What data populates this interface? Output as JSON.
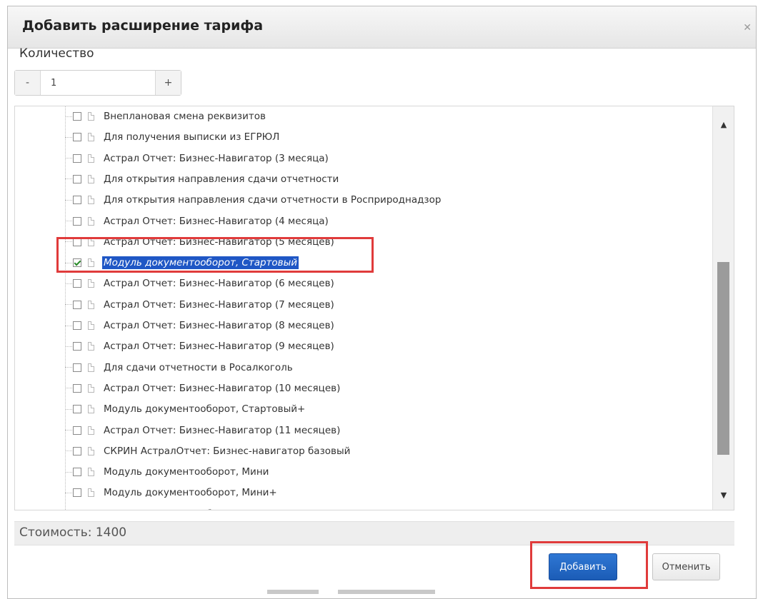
{
  "dialog": {
    "title": "Добавить расширение тарифа",
    "close_icon": "close-icon"
  },
  "quantity": {
    "label": "Количество",
    "minus_label": "-",
    "value": "1",
    "plus_label": "+"
  },
  "tree": {
    "items": [
      {
        "label": "Внеплановая смена реквизитов",
        "checked": false,
        "selected": false
      },
      {
        "label": "Для получения выписки из ЕГРЮЛ",
        "checked": false,
        "selected": false
      },
      {
        "label": "Астрал Отчет: Бизнес-Навигатор (3 месяца)",
        "checked": false,
        "selected": false
      },
      {
        "label": "Для открытия направления сдачи отчетности",
        "checked": false,
        "selected": false
      },
      {
        "label": "Для открытия направления сдачи отчетности в Росприроднадзор",
        "checked": false,
        "selected": false
      },
      {
        "label": "Астрал Отчет: Бизнес-Навигатор (4 месяца)",
        "checked": false,
        "selected": false
      },
      {
        "label": "Астрал Отчет: Бизнес-Навигатор (5 месяцев)",
        "checked": false,
        "selected": false
      },
      {
        "label": "Модуль документооборот, Стартовый",
        "checked": true,
        "selected": true
      },
      {
        "label": "Астрал Отчет: Бизнес-Навигатор (6 месяцев)",
        "checked": false,
        "selected": false
      },
      {
        "label": "Астрал Отчет: Бизнес-Навигатор (7 месяцев)",
        "checked": false,
        "selected": false
      },
      {
        "label": "Астрал Отчет: Бизнес-Навигатор (8 месяцев)",
        "checked": false,
        "selected": false
      },
      {
        "label": "Астрал Отчет: Бизнес-Навигатор (9 месяцев)",
        "checked": false,
        "selected": false
      },
      {
        "label": "Для сдачи отчетности в Росалкоголь",
        "checked": false,
        "selected": false
      },
      {
        "label": "Астрал Отчет: Бизнес-Навигатор (10 месяцев)",
        "checked": false,
        "selected": false
      },
      {
        "label": "Модуль документооборот, Стартовый+",
        "checked": false,
        "selected": false
      },
      {
        "label": "Астрал Отчет: Бизнес-Навигатор (11 месяцев)",
        "checked": false,
        "selected": false
      },
      {
        "label": "СКРИН АстралОтчет: Бизнес-навигатор базовый",
        "checked": false,
        "selected": false
      },
      {
        "label": "Модуль документооборот, Мини",
        "checked": false,
        "selected": false
      },
      {
        "label": "Модуль документооборот, Мини+",
        "checked": false,
        "selected": false
      },
      {
        "label": "Модуль документооборот, Миди",
        "checked": false,
        "selected": false
      }
    ]
  },
  "cost": {
    "text": "Стоимость: 1400"
  },
  "actions": {
    "add_label": "Добавить",
    "cancel_label": "Отменить"
  },
  "colors": {
    "accent": "#1f57c5",
    "highlight": "#e03b3b",
    "add_button": "#2f77d4"
  }
}
